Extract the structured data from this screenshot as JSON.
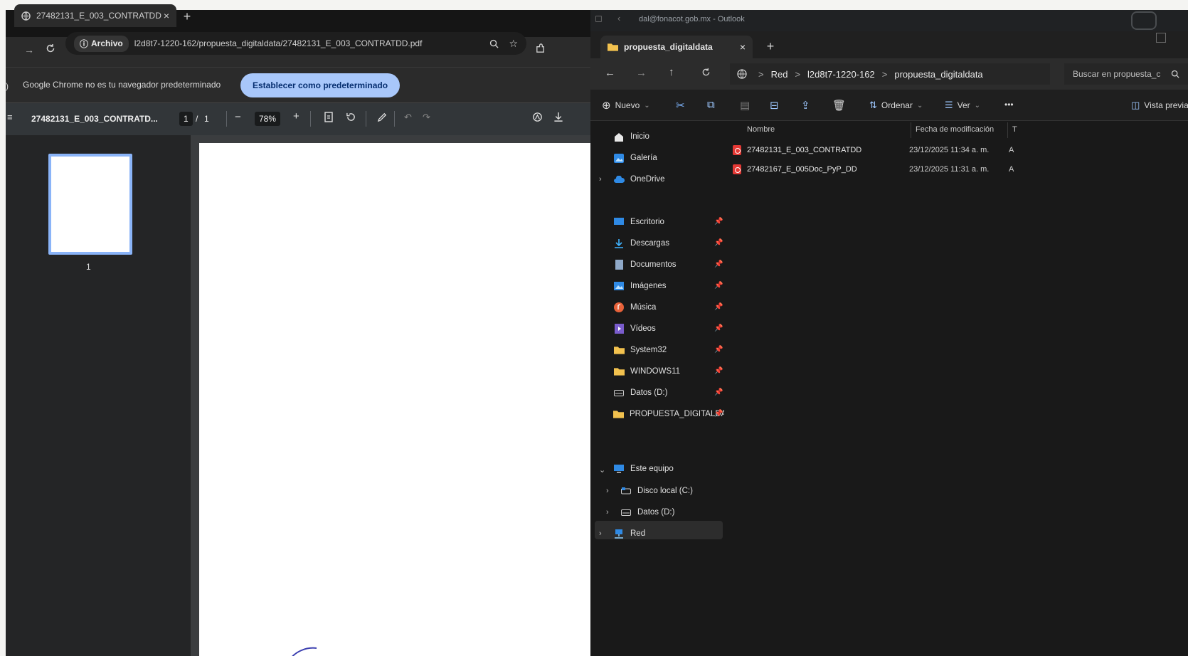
{
  "chrome": {
    "tab_title": "27482131_E_003_CONTRATDD",
    "tab_close": "×",
    "new_tab": "+",
    "omnibox": {
      "scheme_label": "Archivo",
      "url": "l2d8t7-1220-162/propuesta_digitaldata/27482131_E_003_CONTRATDD.pdf"
    },
    "infobar": {
      "message": "Google Chrome no es tu navegador predeterminado",
      "button": "Establecer como predeterminado"
    },
    "pdf_viewer": {
      "doc_title": "27482131_E_003_CONTRATD...",
      "page_current": "1",
      "page_sep": "/",
      "page_total": "1",
      "zoom": "78%",
      "zoom_out": "−",
      "zoom_in": "+",
      "thumbnail_number": "1"
    }
  },
  "outlook": {
    "title": "dal@fonacot.gob.mx - Outlook"
  },
  "explorer": {
    "tab_title": "propuesta_digitaldata",
    "tab_close": "×",
    "new_tab": "+",
    "breadcrumb": [
      "Red",
      "l2d8t7-1220-162",
      "propuesta_digitaldata"
    ],
    "breadcrumb_sep": ">",
    "search_placeholder": "Buscar en propuesta_c",
    "commands": {
      "new": "Nuevo",
      "sort": "Ordenar",
      "view": "Ver",
      "more": "•••",
      "preview": "Vista previa"
    },
    "nav": [
      {
        "label": "Inicio",
        "icon": "home-icon"
      },
      {
        "label": "Galería",
        "icon": "gallery-icon"
      },
      {
        "label": "OneDrive",
        "icon": "cloud-icon"
      },
      {
        "label": "Escritorio",
        "icon": "desktop-icon"
      },
      {
        "label": "Descargas",
        "icon": "download-icon"
      },
      {
        "label": "Documentos",
        "icon": "documents-icon"
      },
      {
        "label": "Imágenes",
        "icon": "pictures-icon"
      },
      {
        "label": "Música",
        "icon": "music-icon"
      },
      {
        "label": "Vídeos",
        "icon": "videos-icon"
      },
      {
        "label": "System32",
        "icon": "folder-icon"
      },
      {
        "label": "WINDOWS11",
        "icon": "folder-icon"
      },
      {
        "label": "Datos (D:)",
        "icon": "drive-icon"
      },
      {
        "label": "PROPUESTA_DIGITALDA",
        "icon": "folder-icon"
      },
      {
        "label": "Este equipo",
        "icon": "computer-icon"
      },
      {
        "label": "Disco local (C:)",
        "icon": "drive-icon"
      },
      {
        "label": "Datos (D:)",
        "icon": "drive-icon"
      },
      {
        "label": "Red",
        "icon": "network-icon"
      }
    ],
    "columns": {
      "name": "Nombre",
      "modified": "Fecha de modificación",
      "type": "T"
    },
    "files": [
      {
        "name": "27482131_E_003_CONTRATDD",
        "modified": "23/12/2025 11:34 a. m.",
        "type": "A"
      },
      {
        "name": "27482167_E_005Doc_PyP_DD",
        "modified": "23/12/2025 11:31 a. m.",
        "type": "A"
      }
    ]
  }
}
